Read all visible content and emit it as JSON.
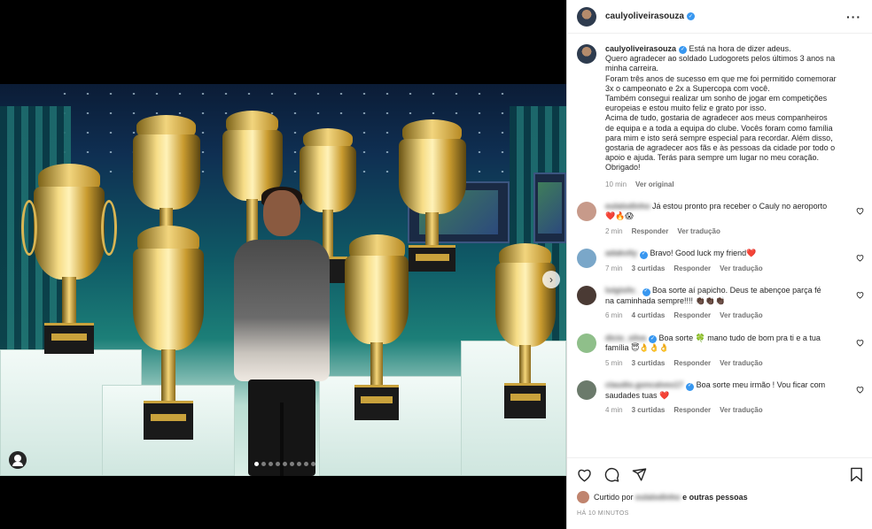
{
  "post": {
    "username": "caulyoliveirasouza",
    "caption_lines": [
      "Está na hora de dizer adeus.",
      "Quero agradecer ao soldado Ludogorets pelos últimos 3 anos na",
      "minha carreira.",
      "Foram três anos de sucesso em que me foi permitido comemorar",
      "3x o campeonato e 2x a Supercopa com você.",
      "Também consegui realizar um sonho de jogar em competições",
      "europeias e estou muito feliz e grato por isso.",
      "Acima de tudo, gostaria de agradecer aos meus companheiros",
      "de equipa e a toda a equipa do clube. Vocês foram como família",
      "para mim e isto será sempre especial para recordar. Além disso,",
      "gostaria de agradecer aos fãs e às pessoas da cidade por todo o",
      "apoio e ajuda. Terás para sempre um lugar no meu coração.",
      "Obrigado!"
    ],
    "caption_time": "10 min",
    "see_original": "Ver original",
    "more_icon": "more-horizontal-icon"
  },
  "comments": [
    {
      "user": "eulalodinho",
      "text_lines": [
        "Já estou pronto pra receber o Cauly no aeroporto",
        "❤️🔥😱"
      ],
      "time": "2 min",
      "likes": "",
      "reply": "Responder",
      "translate": "Ver tradução",
      "verified": false,
      "avatar_color": "#c79a8a"
    },
    {
      "user": "adakvity",
      "text_lines": [
        "Bravo! Good luck my friend❤️"
      ],
      "time": "7 min",
      "likes": "3 curtidas",
      "reply": "Responder",
      "translate": "Ver tradução",
      "verified": true,
      "avatar_color": "#7aa7c9"
    },
    {
      "user": "luigisilv_",
      "text_lines": [
        "Boa sorte aí papicho. Deus te abençoe parça fé",
        "na caminhada sempre!!!! 👏🏿👏🏿👏🏿"
      ],
      "time": "6 min",
      "likes": "4 curtidas",
      "reply": "Responder",
      "translate": "Ver tradução",
      "verified": true,
      "avatar_color": "#4a3a34"
    },
    {
      "user": "dicio_silva",
      "text_lines": [
        "Boa sorte 🍀 mano tudo de bom pra ti e a tua",
        "família 😇👌👌👌"
      ],
      "time": "5 min",
      "likes": "3 curtidas",
      "reply": "Responder",
      "translate": "Ver tradução",
      "verified": true,
      "avatar_color": "#8fbf8a"
    },
    {
      "user": "claudio.goncalves17",
      "text_lines": [
        "Boa sorte meu irmão ! Vou ficar com",
        "saudades tuas ❤️"
      ],
      "time": "4 min",
      "likes": "3 curtidas",
      "reply": "Responder",
      "translate": "Ver tradução",
      "verified": true,
      "avatar_color": "#6b7a6b"
    }
  ],
  "likes": {
    "prefix": "Curtido por",
    "user": "eulalodinho",
    "suffix": "e outras pessoas"
  },
  "time_ago": "HÁ 10 MINUTOS",
  "colors": {
    "verified": "#3897f0",
    "secondary": "#8e8e8e",
    "text": "#262626"
  },
  "icons": [
    "heart-icon",
    "comment-icon",
    "share-icon",
    "bookmark-icon",
    "chevron-right-icon",
    "tag-user-icon"
  ],
  "carousel": {
    "count": 9,
    "active": 1
  }
}
